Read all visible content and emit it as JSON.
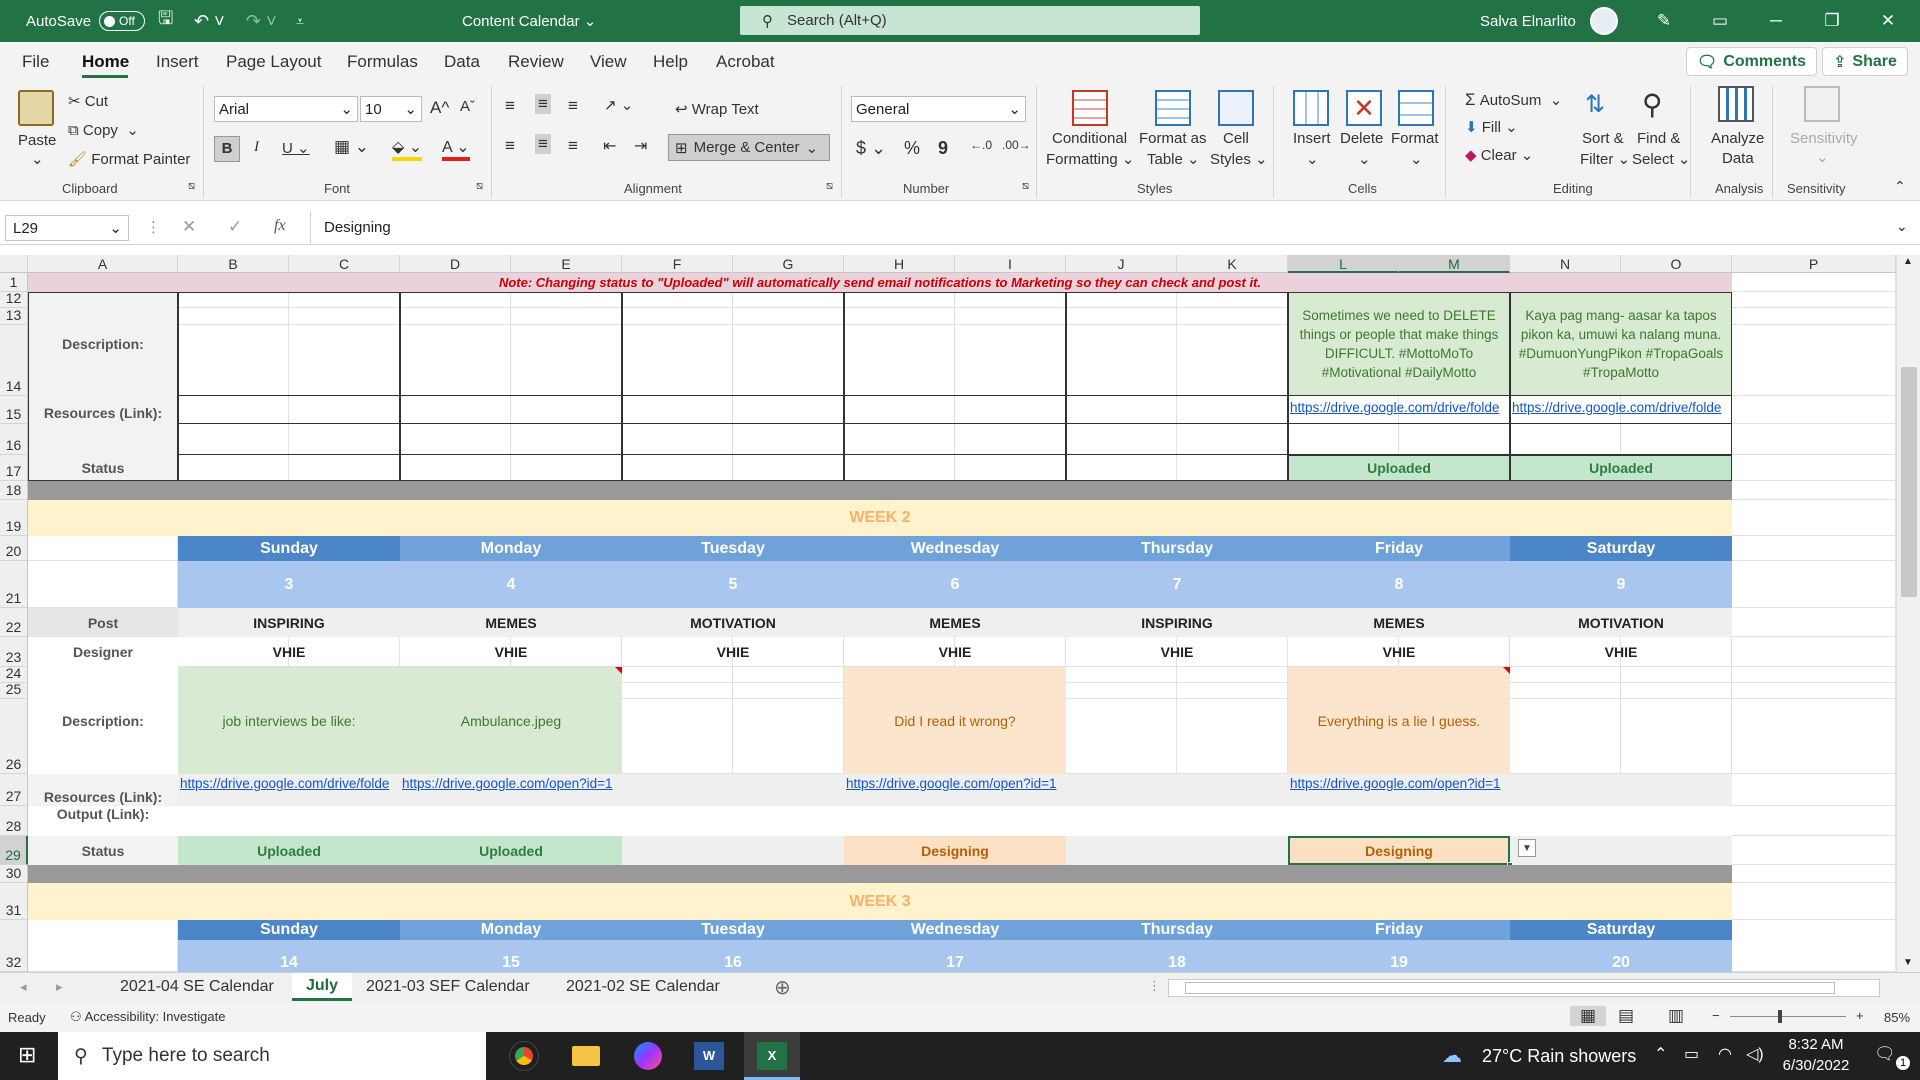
{
  "titlebar": {
    "autosave": "AutoSave",
    "autosave_state": "Off",
    "doc_title": "Content Calendar",
    "search_placeholder": "Search (Alt+Q)",
    "user": "Salva Elnarlito"
  },
  "menu": [
    "File",
    "Home",
    "Insert",
    "Page Layout",
    "Formulas",
    "Data",
    "Review",
    "View",
    "Help",
    "Acrobat"
  ],
  "top_buttons": {
    "comments": "Comments",
    "share": "Share"
  },
  "ribbon": {
    "clipboard": {
      "paste": "Paste",
      "cut": "Cut",
      "copy": "Copy",
      "format_painter": "Format Painter",
      "group": "Clipboard"
    },
    "font": {
      "name": "Arial",
      "size": "10",
      "group": "Font"
    },
    "alignment": {
      "wrap": "Wrap Text",
      "merge": "Merge & Center",
      "group": "Alignment"
    },
    "number": {
      "format": "General",
      "group": "Number"
    },
    "styles": {
      "cond1": "Conditional",
      "cond2": "Formatting",
      "fmt1": "Format as",
      "fmt2": "Table",
      "cell1": "Cell",
      "cell2": "Styles",
      "group": "Styles"
    },
    "cells": {
      "insert": "Insert",
      "delete": "Delete",
      "format": "Format",
      "group": "Cells"
    },
    "editing": {
      "autosum": "AutoSum",
      "fill": "Fill",
      "clear": "Clear",
      "sort1": "Sort &",
      "sort2": "Filter",
      "find1": "Find &",
      "find2": "Select",
      "group": "Editing"
    },
    "analysis": {
      "a1": "Analyze",
      "a2": "Data",
      "group": "Analysis"
    },
    "sensitivity": {
      "label": "Sensitivity",
      "group": "Sensitivity"
    }
  },
  "formula": {
    "cell_ref": "L29",
    "fx": "fx",
    "content": "Designing"
  },
  "columns": [
    "A",
    "B",
    "C",
    "D",
    "E",
    "F",
    "G",
    "H",
    "I",
    "J",
    "K",
    "L",
    "M",
    "N",
    "O",
    "P"
  ],
  "rows": [
    "1",
    "12",
    "13",
    "14",
    "15",
    "16",
    "17",
    "18",
    "19",
    "20",
    "21",
    "22",
    "23",
    "24",
    "25",
    "26",
    "27",
    "28",
    "29",
    "30",
    "31",
    "32"
  ],
  "sheet": {
    "note": "Note: Changing status to \"Uploaded\" will automatically send email notifications to Marketing so they can check and post it.",
    "labels": {
      "description": "Description:",
      "resources": "Resources (Link):",
      "output": "Output (Link):",
      "status": "Status",
      "post": "Post",
      "designer": "Designer"
    },
    "top": {
      "desc_fri": "Sometimes we need to DELETE things or people that make things DIFFICULT. #MottoMoTo #Motivational #DailyMotto",
      "desc_sat": "Kaya pag mang- aasar ka tapos pikon ka, umuwi ka nalang muna. #DumuonYungPikon #TropaGoals #TropaMotto",
      "link_fri": "https://drive.google.com/drive/folde",
      "link_sat": "https://drive.google.com/drive/folde",
      "status_fri": "Uploaded",
      "status_sat": "Uploaded"
    },
    "week2": {
      "title": "WEEK 2",
      "days": [
        "Sunday",
        "Monday",
        "Tuesday",
        "Wednesday",
        "Thursday",
        "Friday",
        "Saturday"
      ],
      "dates": [
        "3",
        "4",
        "5",
        "6",
        "7",
        "8",
        "9"
      ],
      "posts": [
        "INSPIRING",
        "MEMES",
        "MOTIVATION",
        "MEMES",
        "INSPIRING",
        "MEMES",
        "MOTIVATION"
      ],
      "designers": [
        "VHIE",
        "VHIE",
        "VHIE",
        "VHIE",
        "VHIE",
        "VHIE",
        "VHIE"
      ],
      "descriptions": [
        "job interviews be like:",
        "Ambulance.jpeg",
        "",
        "Did I read it wrong?",
        "",
        "Everything is a lie I guess.",
        ""
      ],
      "links": [
        "https://drive.google.com/drive/folde",
        "https://drive.google.com/open?id=1",
        "",
        "https://drive.google.com/open?id=1",
        "",
        "https://drive.google.com/open?id=1",
        ""
      ],
      "statuses": [
        "Uploaded",
        "Uploaded",
        "",
        "Designing",
        "",
        "Designing",
        ""
      ]
    },
    "week3": {
      "title": "WEEK 3",
      "days": [
        "Sunday",
        "Monday",
        "Tuesday",
        "Wednesday",
        "Thursday",
        "Friday",
        "Saturday"
      ],
      "dates": [
        "14",
        "15",
        "16",
        "17",
        "18",
        "19",
        "20"
      ]
    }
  },
  "tabs": [
    "2021-04 SE Calendar",
    "July",
    "2021-03 SEF Calendar",
    "2021-02 SE Calendar"
  ],
  "status": {
    "ready": "Ready",
    "accessibility": "Accessibility: Investigate",
    "zoom": "85%"
  },
  "taskbar": {
    "search": "Type here to search",
    "weather": "27°C  Rain showers",
    "time": "8:32 AM",
    "date": "6/30/2022",
    "notif": "1"
  }
}
